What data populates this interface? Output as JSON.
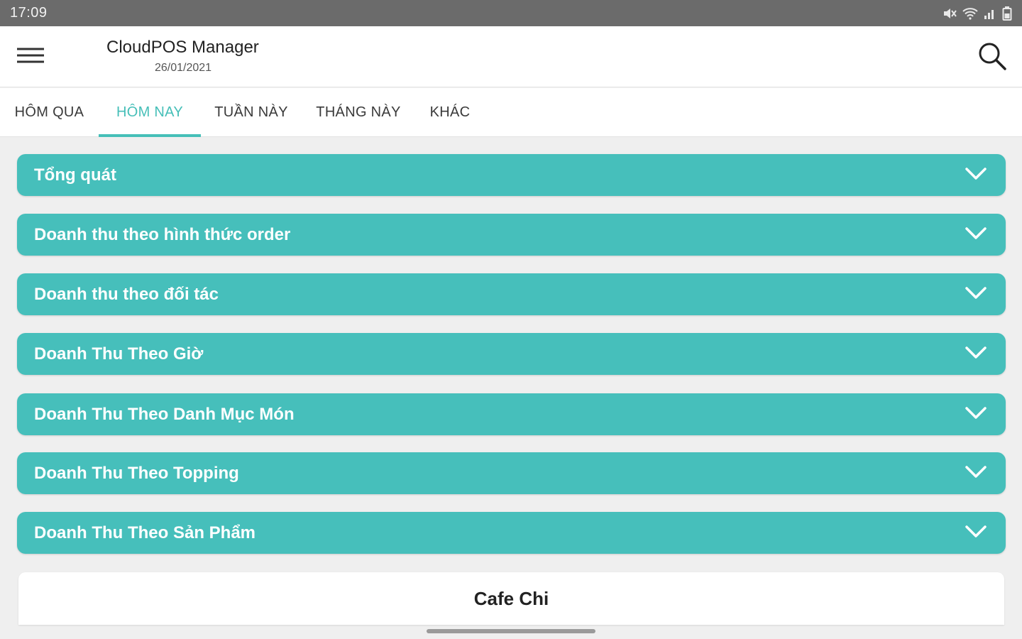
{
  "status_bar": {
    "time": "17:09",
    "icons": [
      "mute-icon",
      "wifi-icon",
      "signal-icon",
      "battery-icon"
    ]
  },
  "app_bar": {
    "title": "CloudPOS Manager",
    "date": "26/01/2021",
    "menu_icon": "hamburger-icon",
    "search_icon": "search-icon"
  },
  "tabs": [
    {
      "label": "HÔM QUA",
      "active": false
    },
    {
      "label": "HÔM NAY",
      "active": true
    },
    {
      "label": "TUẦN NÀY",
      "active": false
    },
    {
      "label": "THÁNG NÀY",
      "active": false
    },
    {
      "label": "KHÁC",
      "active": false
    }
  ],
  "sections": [
    {
      "label": "Tổng quát",
      "icon": "chevron-down-icon"
    },
    {
      "label": "Doanh thu theo hình thức order",
      "icon": "chevron-down-icon"
    },
    {
      "label": "Doanh thu theo đối tác",
      "icon": "chevron-down-icon"
    },
    {
      "label": "Doanh Thu Theo Giờ",
      "icon": "chevron-down-icon"
    },
    {
      "label": "Doanh Thu Theo Danh Mục Món",
      "icon": "chevron-down-icon"
    },
    {
      "label": "Doanh Thu Theo Topping",
      "icon": "chevron-down-icon"
    },
    {
      "label": "Doanh Thu Theo Sản Phẩm",
      "icon": "chevron-down-icon"
    }
  ],
  "store": {
    "name": "Cafe Chi"
  },
  "colors": {
    "accent": "#46bfbb",
    "status_bar": "#6b6b6b",
    "background": "#efefef"
  }
}
